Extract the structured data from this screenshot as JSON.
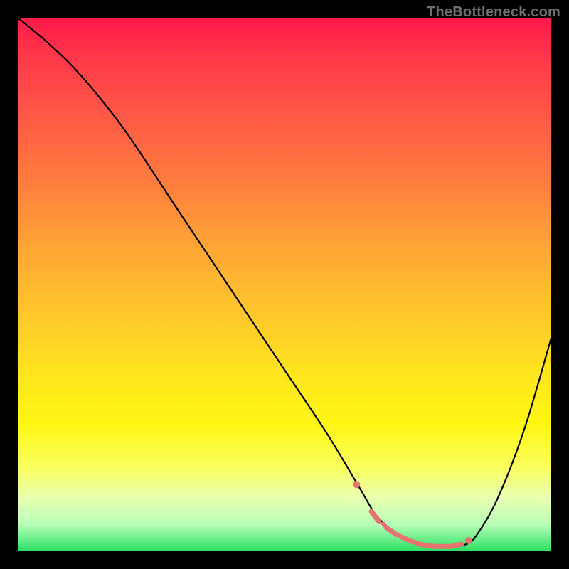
{
  "watermark": "TheBottleneck.com",
  "colors": {
    "frame_bg_top": "#ff1a4b",
    "frame_bg_bottom": "#28e060",
    "curve": "#000000",
    "marker": "#e6736f",
    "page_bg": "#000000",
    "watermark": "#6f6f6f"
  },
  "chart_data": {
    "type": "line",
    "title": "",
    "xlabel": "",
    "ylabel": "",
    "xlim": [
      0,
      100
    ],
    "ylim": [
      0,
      100
    ],
    "grid": false,
    "legend": false,
    "series": [
      {
        "name": "bottleneck-curve",
        "x": [
          0,
          6,
          12,
          20,
          30,
          40,
          50,
          58,
          64,
          67,
          70,
          73,
          77,
          81,
          84,
          86,
          90,
          95,
          100
        ],
        "values": [
          100,
          95,
          89,
          79,
          64,
          49,
          34,
          22,
          12,
          7,
          4,
          2.2,
          1.0,
          0.8,
          1.3,
          3,
          10,
          23,
          40
        ]
      }
    ],
    "markers": {
      "name": "highlight-range",
      "x": [
        63.5,
        67,
        70,
        73,
        76,
        79,
        82,
        84.5
      ],
      "values": [
        12.5,
        6.5,
        3.8,
        2.2,
        1.2,
        0.9,
        1.1,
        2.0
      ],
      "style": "dot-dash"
    }
  }
}
